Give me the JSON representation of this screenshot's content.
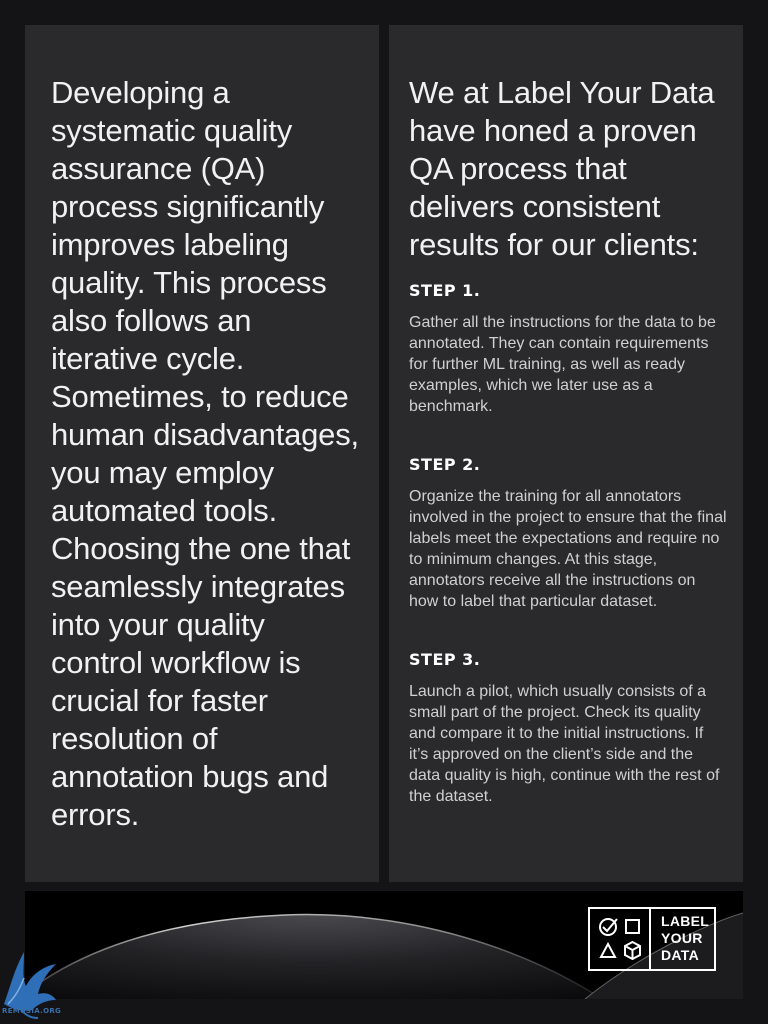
{
  "left_card": {
    "text": "Developing a systematic quality assurance (QA) process significantly improves labeling quality. This process also follows an iterative cycle. Sometimes, to reduce human disadvantages, you may employ automated tools. Choosing the one that seamlessly integrates into your quality control workflow is crucial for faster resolution of annotation bugs and errors."
  },
  "right_card": {
    "intro": "We at Label Your Data have honed a proven QA process that delivers consistent results for our clients:",
    "steps": [
      {
        "title": "STEP 1.",
        "body": "Gather all the instructions for the data to be annotated. They can contain requirements for further ML training, as well as ready examples, which we later use as a benchmark."
      },
      {
        "title": "STEP 2.",
        "body": "Organize the training for all annotators involved in the project to ensure that the final labels meet the expectations and require no to minimum changes. At this stage, annotators receive all the instructions on how to label that particular dataset."
      },
      {
        "title": "STEP 3.",
        "body": "Launch a pilot, which usually consists of a small part of the project. Check its quality and compare it to the initial instructions. If it’s approved on the client’s side and the data quality is high, continue with the rest of the dataset."
      }
    ]
  },
  "logo": {
    "line1": "LABEL",
    "line2": "YOUR",
    "line3": "DATA",
    "icons": [
      "checkmark-circle-icon",
      "square-icon",
      "triangle-icon",
      "cube-icon"
    ]
  },
  "watermark": {
    "text": "REMUSIA.ORG",
    "icon": "bird-logo-icon"
  },
  "colors": {
    "page_background": "#141416",
    "card_background": "#2a2a2c",
    "text": "#f1f1f1",
    "body_text": "#d0d0d0",
    "banner_background": "#000000",
    "watermark": "#3a6ea8"
  }
}
